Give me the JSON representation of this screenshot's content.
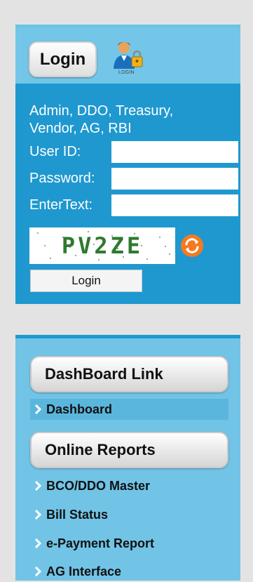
{
  "login_panel": {
    "header_button": "Login",
    "user_icon_caption": "LOGIN",
    "roles_text": "Admin, DDO, Treasury,\nVendor, AG, RBI",
    "fields": [
      {
        "label": "User ID:",
        "value": ""
      },
      {
        "label": "Password:",
        "value": ""
      },
      {
        "label": "EnterText:",
        "value": ""
      }
    ],
    "captcha_text": "PV2ZE",
    "submit_label": "Login"
  },
  "links_panel": {
    "dashboard_section": "DashBoard Link",
    "dashboard_items": [
      {
        "label": "Dashboard"
      }
    ],
    "reports_section": "Online Reports",
    "report_items": [
      {
        "label": "BCO/DDO Master"
      },
      {
        "label": "Bill Status"
      },
      {
        "label": "e-Payment Report"
      },
      {
        "label": "AG Interface"
      }
    ]
  },
  "colors": {
    "panel_dark_blue": "#1f98cf",
    "panel_light_blue": "#71c4e6",
    "page_background": "#e3e3e3",
    "captcha_text": "#2f7a2f",
    "refresh_icon": "#f47a20"
  },
  "icons": {
    "user_login": "user-lock-icon",
    "captcha_refresh": "refresh-icon",
    "nav_bullet": "chevron-right-icon"
  }
}
